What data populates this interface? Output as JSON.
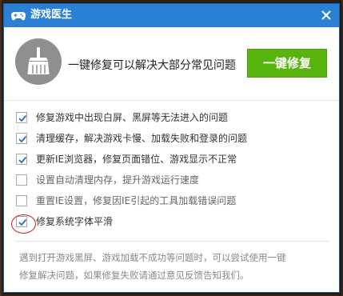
{
  "window": {
    "title": "游戏医生",
    "close_symbol": "×"
  },
  "hero": {
    "text": "一键修复可以解决大部分常见问题",
    "fix_button_label": "一键修复",
    "icon": "broom-icon"
  },
  "options": [
    {
      "label": "修复游戏中出现白屏、黑屏等无法进入的问题",
      "checked": true
    },
    {
      "label": "清理缓存，解决游戏卡慢、加载失败和登录的问题",
      "checked": true
    },
    {
      "label": "更新IE浏览器，修复页面错位、游戏显示不正常",
      "checked": true
    },
    {
      "label": "设置自动清理内存，提升游戏运行速度",
      "checked": false
    },
    {
      "label": "重置IE设置，修复因IE引起的工具加载错误问题",
      "checked": false
    },
    {
      "label": "修复系统字体平滑",
      "checked": true
    }
  ],
  "hint": {
    "line1": "遇到打开游戏黑屏、游戏加载不成功等问题时，可以尝试使用一键",
    "line2": "修复解决问题，如果修复失败请通过意见反馈告知我们。"
  },
  "colors": {
    "titlebar": "#2a80d5",
    "fix_button": "#57b40c",
    "checkmark": "#2a6fbf",
    "highlight_circle": "#d4202a"
  }
}
